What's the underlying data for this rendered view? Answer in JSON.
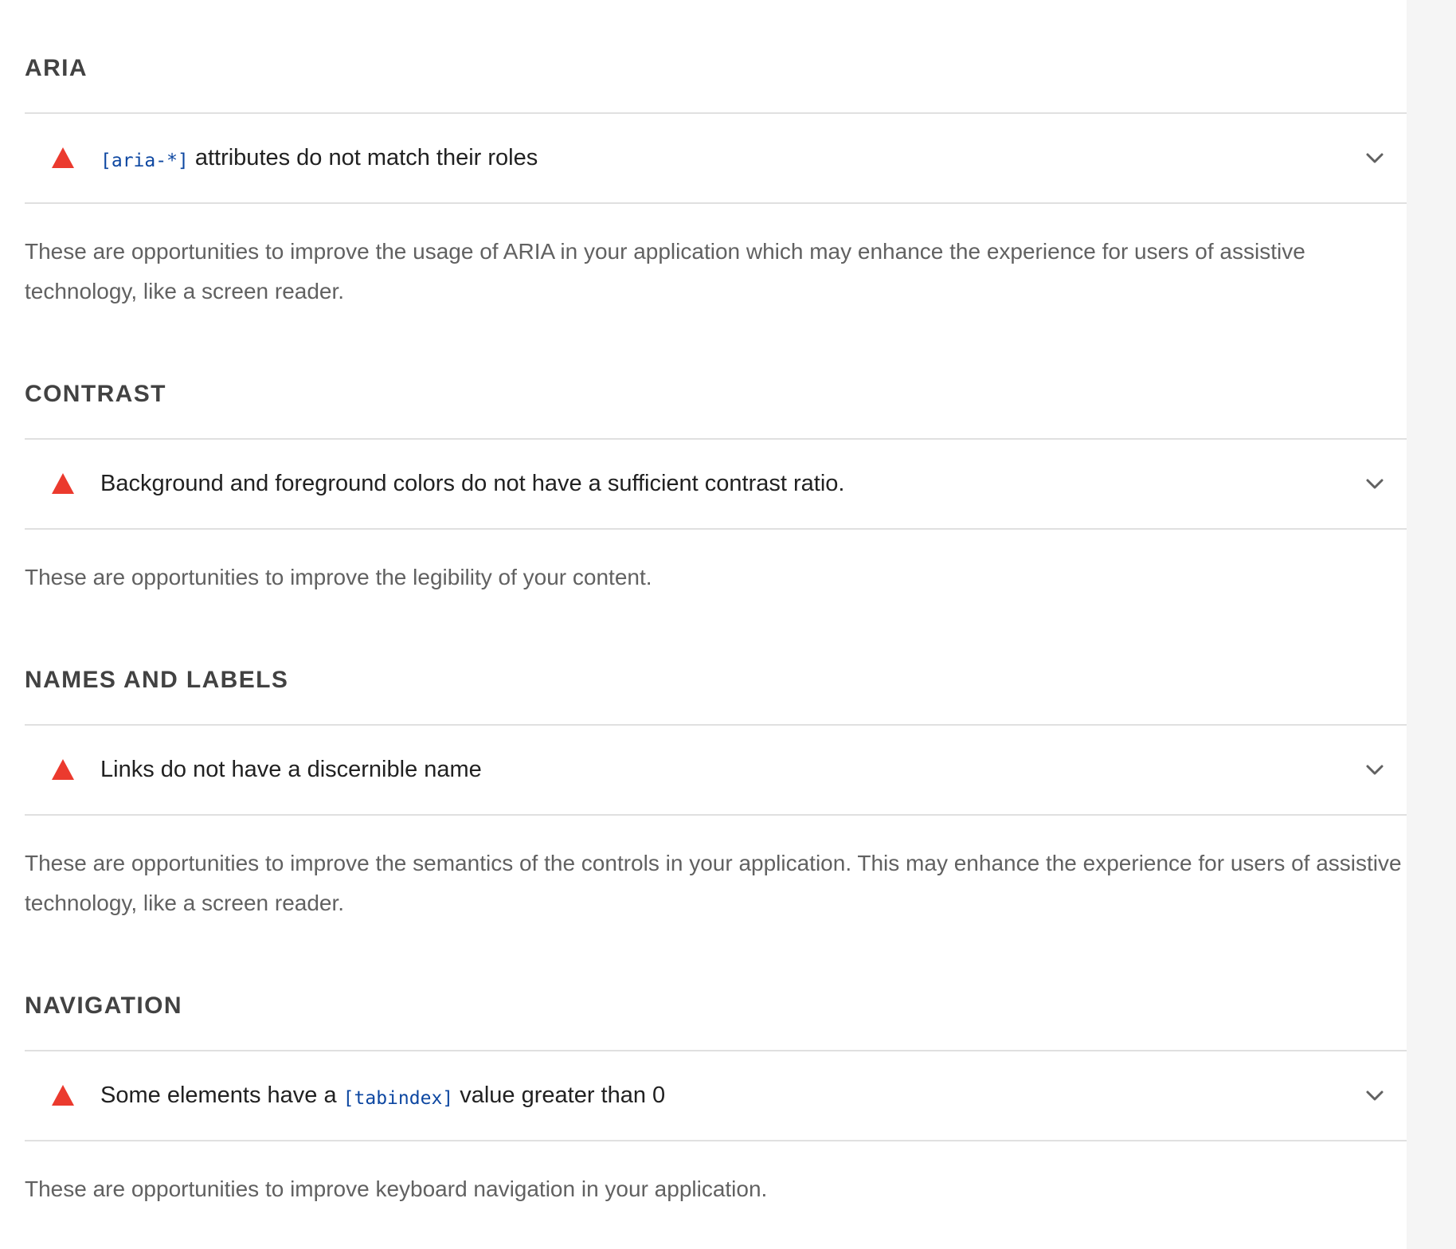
{
  "groups": [
    {
      "title": "ARIA",
      "audit": {
        "code": "[aria-*]",
        "text_before": "",
        "text_after": " attributes do not match their roles"
      },
      "description": "These are opportunities to improve the usage of ARIA in your application which may enhance the experience for users of assistive technology, like a screen reader."
    },
    {
      "title": "CONTRAST",
      "audit": {
        "code": "",
        "text_before": "Background and foreground colors do not have a sufficient contrast ratio.",
        "text_after": ""
      },
      "description": "These are opportunities to improve the legibility of your content."
    },
    {
      "title": "NAMES AND LABELS",
      "audit": {
        "code": "",
        "text_before": "Links do not have a discernible name",
        "text_after": ""
      },
      "description": "These are opportunities to improve the semantics of the controls in your application. This may enhance the experience for users of assistive technology, like a screen reader."
    },
    {
      "title": "NAVIGATION",
      "audit": {
        "code": "[tabindex]",
        "text_before": "Some elements have a ",
        "text_after": " value greater than 0"
      },
      "description": "These are opportunities to improve keyboard navigation in your application."
    }
  ],
  "icons": {
    "fail": "warning-triangle-icon",
    "expand": "chevron-down-icon"
  },
  "colors": {
    "fail": "#eb3a2e",
    "code": "#0d47a1",
    "divider": "#e0e0e0",
    "heading": "#424242",
    "description": "#616161"
  }
}
